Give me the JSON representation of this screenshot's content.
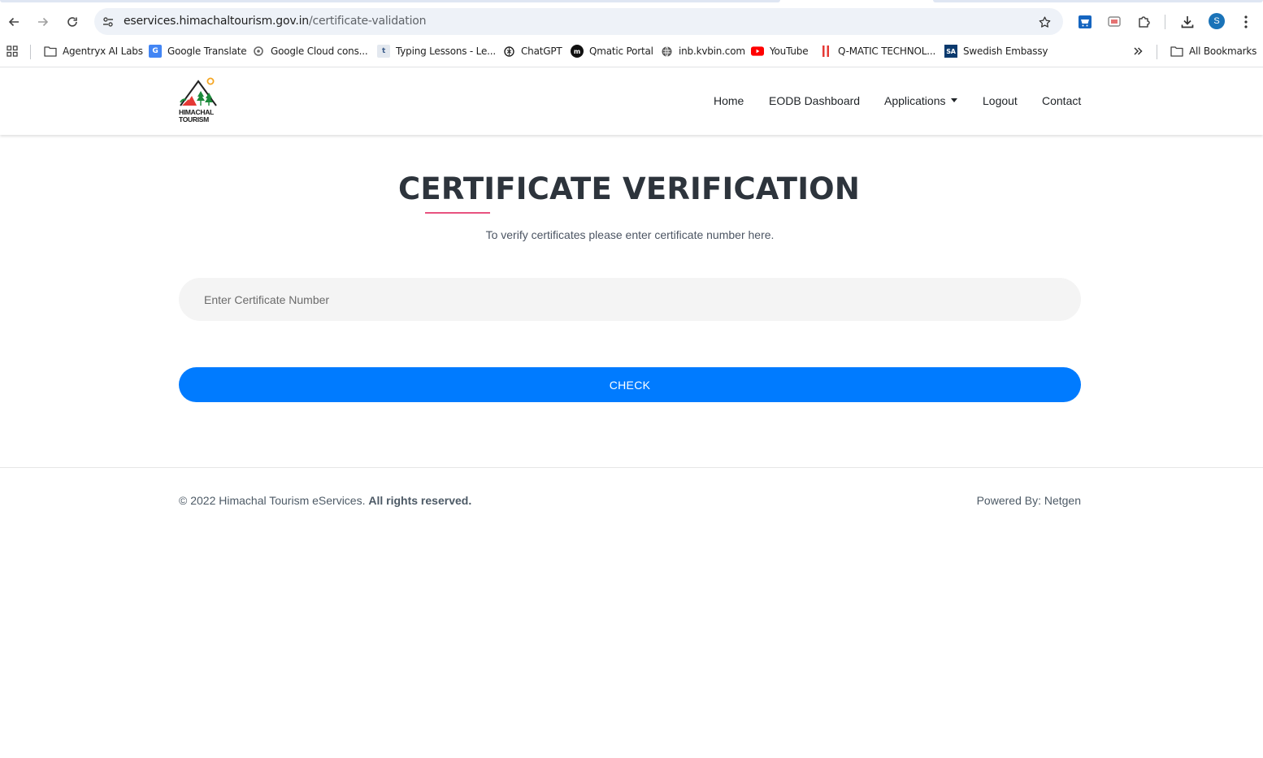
{
  "browser": {
    "url_host": "eservices.himachaltourism.gov.in",
    "url_path": "/certificate-validation",
    "profile_initial": "S",
    "bookmarks": [
      {
        "label": "Agentryx AI Labs",
        "icon": "folder-icon"
      },
      {
        "label": "Google Translate",
        "icon": "google-translate-icon"
      },
      {
        "label": "Google Cloud cons...",
        "icon": "google-cloud-icon"
      },
      {
        "label": "Typing Lessons - Le...",
        "icon": "typing-icon"
      },
      {
        "label": "ChatGPT",
        "icon": "chatgpt-icon"
      },
      {
        "label": "Qmatic Portal",
        "icon": "qmatic-icon"
      },
      {
        "label": "inb.kvbin.com",
        "icon": "globe-icon"
      },
      {
        "label": "YouTube",
        "icon": "youtube-icon"
      },
      {
        "label": "Q-MATIC TECHNOL...",
        "icon": "qmatic-tech-icon"
      },
      {
        "label": "Swedish Embassy",
        "icon": "sa-icon"
      }
    ],
    "all_bookmarks": "All Bookmarks"
  },
  "header": {
    "logo_text_line1": "HIMACHAL",
    "logo_text_line2": "TOURISM",
    "nav": {
      "home": "Home",
      "eodb": "EODB Dashboard",
      "applications": "Applications",
      "logout": "Logout",
      "contact": "Contact"
    }
  },
  "main": {
    "title": "CERTIFICATE VERIFICATION",
    "subtitle": "To verify certificates please enter certificate number here.",
    "input_placeholder": "Enter Certificate Number",
    "input_value": "",
    "check_label": "CHECK"
  },
  "footer": {
    "copyright_prefix": "© 2022 Himachal Tourism eServices.",
    "copyright_bold": "All rights reserved.",
    "powered": "Powered By: Netgen"
  },
  "colors": {
    "accent": "#007bff",
    "underline": "#e8527f",
    "title": "#2d343c"
  }
}
